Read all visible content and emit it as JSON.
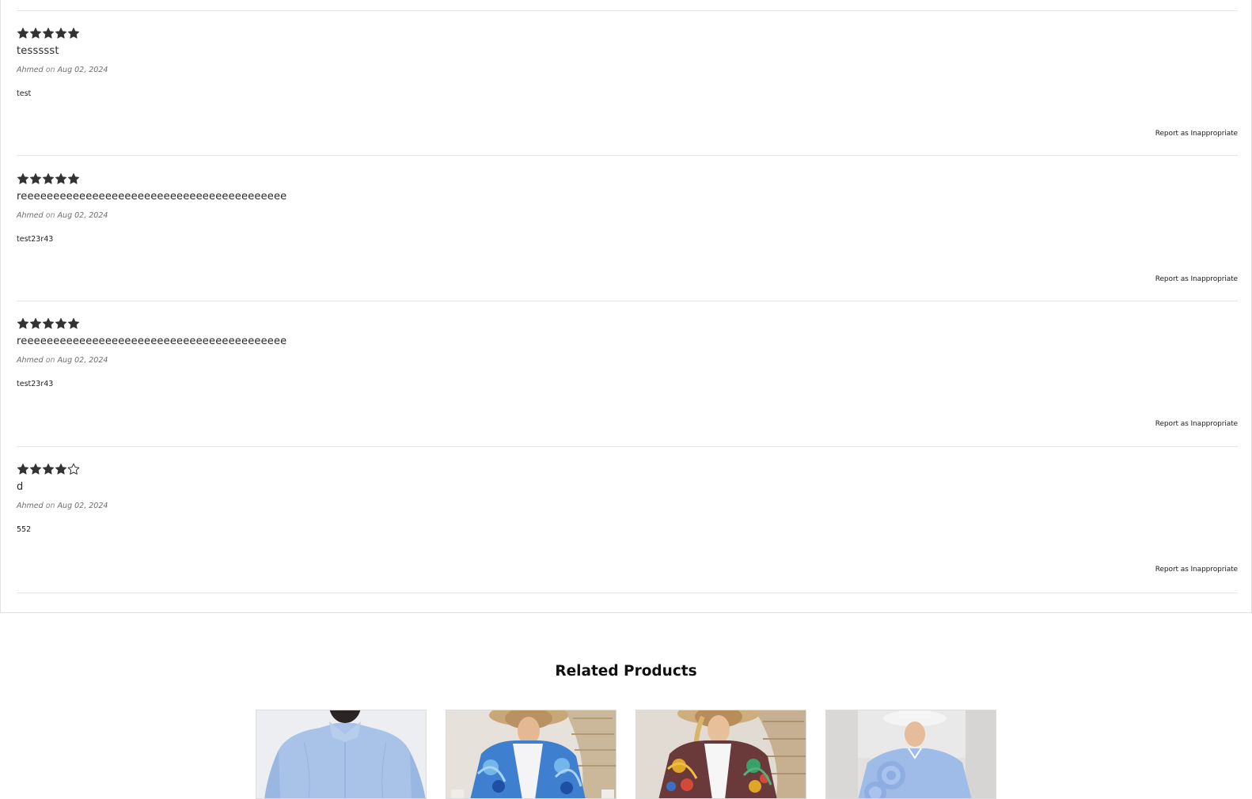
{
  "reviews": [
    {
      "stars": 5,
      "title": "tessssst",
      "author": "Ahmed",
      "on": "on",
      "date": "Aug 02, 2024",
      "body": "test",
      "report": "Report as Inappropriate"
    },
    {
      "stars": 5,
      "title": "reeeeeeeeeeeeeeeeeeeeeeeeeeeeeeeeeeeeeeeee",
      "author": "Ahmed",
      "on": "on",
      "date": "Aug 02, 2024",
      "body": "test23r43",
      "report": "Report as Inappropriate"
    },
    {
      "stars": 5,
      "title": "reeeeeeeeeeeeeeeeeeeeeeeeeeeeeeeeeeeeeeeee",
      "author": "Ahmed",
      "on": "on",
      "date": "Aug 02, 2024",
      "body": "test23r43",
      "report": "Report as Inappropriate"
    },
    {
      "stars": 4,
      "title": "d",
      "author": "Ahmed",
      "on": "on",
      "date": "Aug 02, 2024",
      "body": "552",
      "report": "Report as Inappropriate"
    }
  ],
  "related": {
    "title": "Related Products",
    "products": [
      {
        "image": "light-blue-shirt-back-view"
      },
      {
        "image": "blue-floral-kimono-with-straw-hat"
      },
      {
        "image": "colorful-patterned-kimono-with-straw-hat"
      },
      {
        "image": "light-blue-ruffled-shirt-with-white-hat"
      }
    ]
  },
  "colors": {
    "star": "#333333",
    "rule": "#e4e4e4",
    "text": "#222222"
  }
}
